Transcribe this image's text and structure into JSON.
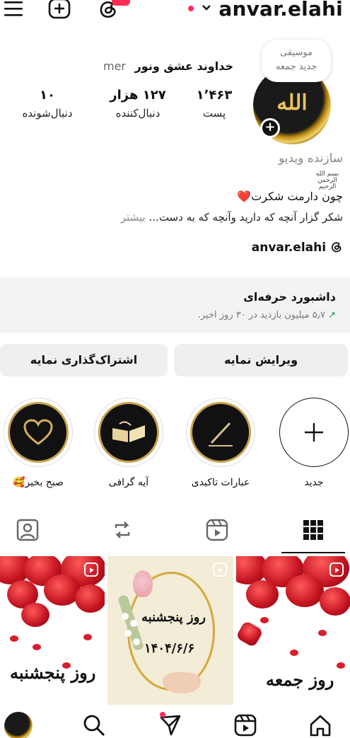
{
  "topbar": {
    "username": "anvar.elahi",
    "icons": [
      "menu-icon",
      "add-post-icon",
      "threads-icon",
      "account-switch-chevron-icon"
    ]
  },
  "profile": {
    "note": [
      "موسیقی",
      "جدید جمعه"
    ],
    "avatar_text": "الله",
    "display_name": "خداوند عشق ونور",
    "pronoun": "mer",
    "stats": [
      {
        "value": "۱٬۴۶۳",
        "label": "پست"
      },
      {
        "value": "۱۲۷ هزار",
        "label": "دنبال‌کننده"
      },
      {
        "value": "۱۰",
        "label": "دنبال‌شونده"
      }
    ],
    "category": "سازنده ویدیو",
    "bismillah": "بسم الله الرحمن الرحیم",
    "bio_line1": "چون دارمت شکرت",
    "bio_heart": "❤️",
    "bio_line2": "شکر گزار آنچه که دارید وآنچه که به دست...",
    "bio_more": "بیشتر",
    "threads_handle": "anvar.elahi"
  },
  "dashboard": {
    "title": "داشبورد حرفه‌ای",
    "subtitle": "۵٫۷ میلیون بازدید در ۳۰ روز اخیر."
  },
  "buttons": {
    "edit_profile": "ویرایش نمایه",
    "share_profile": "اشتراک‌گذاری نمایه"
  },
  "highlights": [
    {
      "label": "جدید"
    },
    {
      "label": "عبارات تاکیدی"
    },
    {
      "label": "آیه گرافی"
    },
    {
      "label": "صبح بخیر🥰"
    }
  ],
  "tabs": [
    "grid-icon",
    "reels-icon",
    "reposts-icon",
    "tagged-icon"
  ],
  "posts": [
    {
      "caption": "روز پنجشنبه"
    },
    {
      "caption": "روز پنجشنبه",
      "date": "۱۴۰۴/۶/۶"
    },
    {
      "caption": "روز جمعه"
    }
  ],
  "colors": {
    "accent_red": "#ff2d55",
    "gold": "#c9a24a",
    "dashboard_bg": "#f2f3f5",
    "button_bg": "#eeeff1",
    "trend_green": "#1a9b4b"
  }
}
